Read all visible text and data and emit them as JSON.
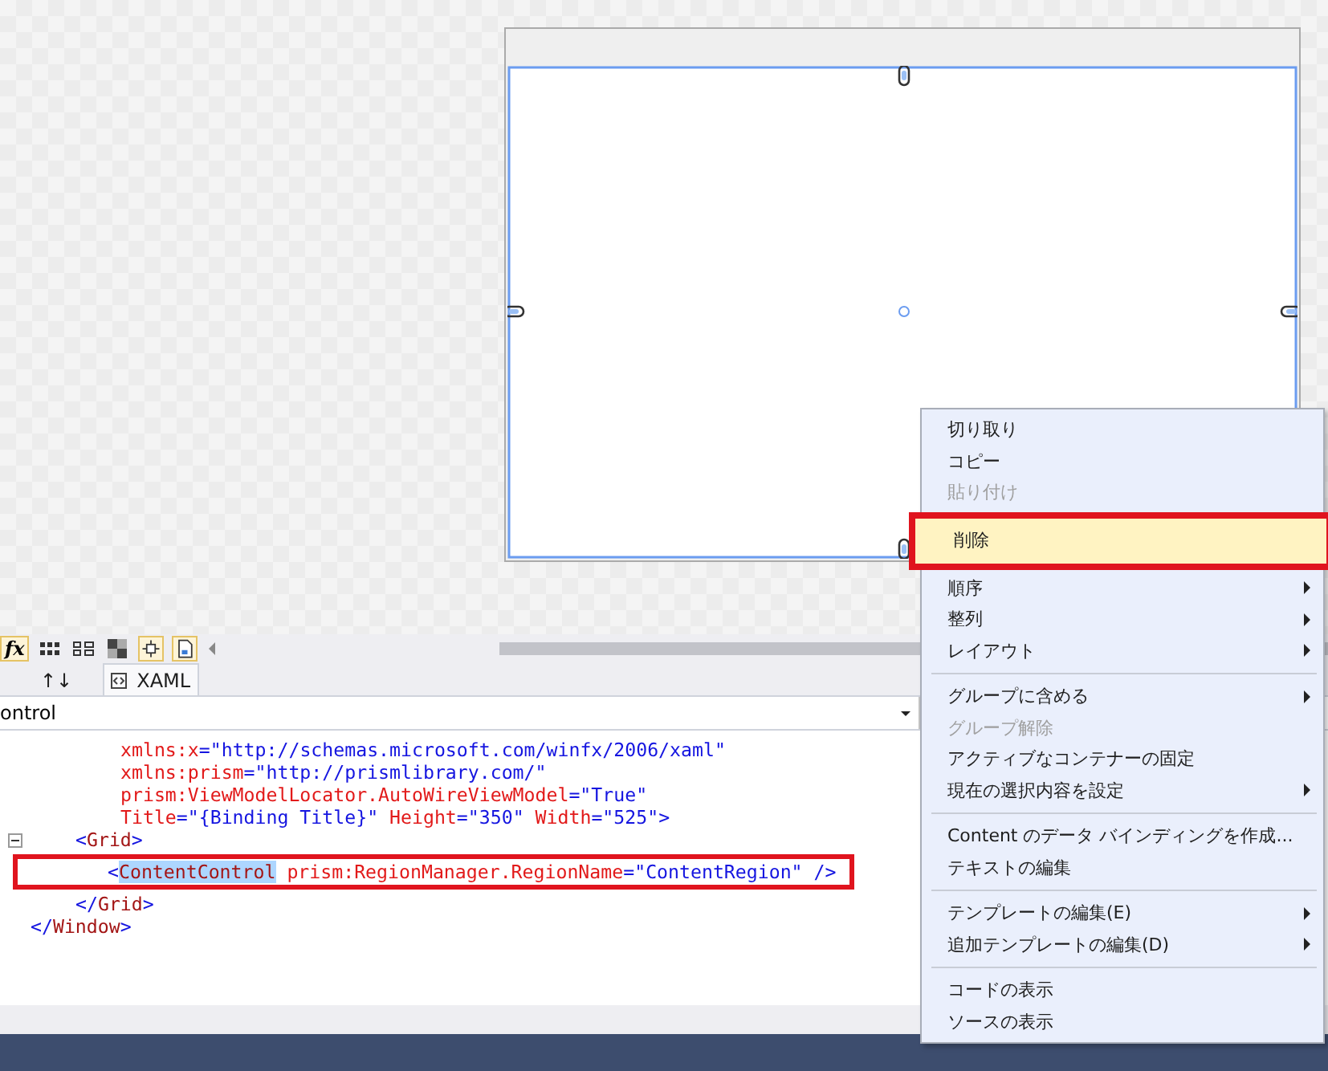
{
  "toolbar": {
    "formula_label": "fx"
  },
  "tabs": [
    {
      "label": "↑↓",
      "selected": false
    },
    {
      "label": "XAML",
      "selected": true
    }
  ],
  "element_picker": {
    "value": "ontrol"
  },
  "code": {
    "lines": [
      {
        "highlighted": false,
        "fold": false,
        "kind": "attribute",
        "segments": [
          {
            "text": "xmlns:x",
            "kind": "attr"
          },
          {
            "text": "=\"http://schemas.microsoft.com/winfx/2006/xaml\"",
            "kind": "value"
          }
        ]
      },
      {
        "highlighted": false,
        "fold": false,
        "kind": "attribute",
        "segments": [
          {
            "text": "xmlns:prism",
            "kind": "attr"
          },
          {
            "text": "=\"http://prismlibrary.com/\"",
            "kind": "value"
          }
        ]
      },
      {
        "highlighted": false,
        "fold": false,
        "kind": "attribute",
        "segments": [
          {
            "text": "prism:ViewModelLocator.AutoWireViewModel",
            "kind": "attr"
          },
          {
            "text": "=\"True\"",
            "kind": "value"
          }
        ]
      },
      {
        "highlighted": false,
        "fold": false,
        "kind": "attribute",
        "segments": [
          {
            "text": "Title",
            "kind": "attr"
          },
          {
            "text": "=\"{Binding Title}\"",
            "kind": "value"
          },
          {
            "text": " Height",
            "kind": "attr"
          },
          {
            "text": "=\"350\"",
            "kind": "value"
          },
          {
            "text": " Width",
            "kind": "attr"
          },
          {
            "text": "=\"525\">",
            "kind": "value"
          }
        ]
      },
      {
        "highlighted": false,
        "fold": true,
        "kind": "element",
        "segments": [
          {
            "text": "<",
            "kind": "punct"
          },
          {
            "text": "Grid",
            "kind": "tag"
          },
          {
            "text": ">",
            "kind": "punct"
          }
        ]
      },
      {
        "highlighted": true,
        "fold": false,
        "kind": "child",
        "segments": [
          {
            "text": "<",
            "kind": "punct"
          },
          {
            "text": "ContentControl",
            "kind": "selection"
          },
          {
            "text": " prism:RegionManager.RegionName",
            "kind": "attr"
          },
          {
            "text": "=\"ContentRegion\" />",
            "kind": "value"
          }
        ]
      },
      {
        "highlighted": false,
        "fold": false,
        "kind": "element",
        "segments": [
          {
            "text": "</",
            "kind": "punct"
          },
          {
            "text": "Grid",
            "kind": "tag"
          },
          {
            "text": ">",
            "kind": "punct"
          }
        ]
      },
      {
        "highlighted": false,
        "fold": false,
        "kind": "root",
        "segments": [
          {
            "text": "</",
            "kind": "punct"
          },
          {
            "text": "Window",
            "kind": "tag"
          },
          {
            "text": ">",
            "kind": "punct"
          }
        ]
      }
    ]
  },
  "context_menu": {
    "items": [
      {
        "kind": "item",
        "label": "切り取り",
        "disabled": false,
        "selected": false,
        "submenu": false,
        "callout": false
      },
      {
        "kind": "item",
        "label": "コピー",
        "disabled": false,
        "selected": false,
        "submenu": false,
        "callout": false
      },
      {
        "kind": "item",
        "label": "貼り付け",
        "disabled": true,
        "selected": false,
        "submenu": false,
        "callout": false
      },
      {
        "kind": "item",
        "label": "削除",
        "disabled": false,
        "selected": true,
        "submenu": false,
        "callout": true
      },
      {
        "kind": "item",
        "label": "順序",
        "disabled": false,
        "selected": false,
        "submenu": true,
        "callout": false
      },
      {
        "kind": "item",
        "label": "整列",
        "disabled": false,
        "selected": false,
        "submenu": true,
        "callout": false
      },
      {
        "kind": "item",
        "label": "レイアウト",
        "disabled": false,
        "selected": false,
        "submenu": true,
        "callout": false
      },
      {
        "kind": "separator"
      },
      {
        "kind": "item",
        "label": "グループに含める",
        "disabled": false,
        "selected": false,
        "submenu": true,
        "callout": false
      },
      {
        "kind": "item",
        "label": "グループ解除",
        "disabled": true,
        "selected": false,
        "submenu": false,
        "callout": false
      },
      {
        "kind": "item",
        "label": "アクティブなコンテナーの固定",
        "disabled": false,
        "selected": false,
        "submenu": false,
        "callout": false
      },
      {
        "kind": "item",
        "label": "現在の選択内容を設定",
        "disabled": false,
        "selected": false,
        "submenu": true,
        "callout": false
      },
      {
        "kind": "separator"
      },
      {
        "kind": "item",
        "label": "Content のデータ バインディングを作成...",
        "disabled": false,
        "selected": false,
        "submenu": false,
        "callout": false
      },
      {
        "kind": "item",
        "label": "テキストの編集",
        "disabled": false,
        "selected": false,
        "submenu": false,
        "callout": false
      },
      {
        "kind": "separator"
      },
      {
        "kind": "item",
        "label": "テンプレートの編集(E)",
        "disabled": false,
        "selected": false,
        "submenu": true,
        "callout": false
      },
      {
        "kind": "item",
        "label": "追加テンプレートの編集(D)",
        "disabled": false,
        "selected": false,
        "submenu": true,
        "callout": false
      },
      {
        "kind": "separator"
      },
      {
        "kind": "item",
        "label": "コードの表示",
        "disabled": false,
        "selected": false,
        "submenu": false,
        "callout": false
      },
      {
        "kind": "item",
        "label": "ソースの表示",
        "disabled": false,
        "selected": false,
        "submenu": false,
        "callout": false
      }
    ]
  }
}
